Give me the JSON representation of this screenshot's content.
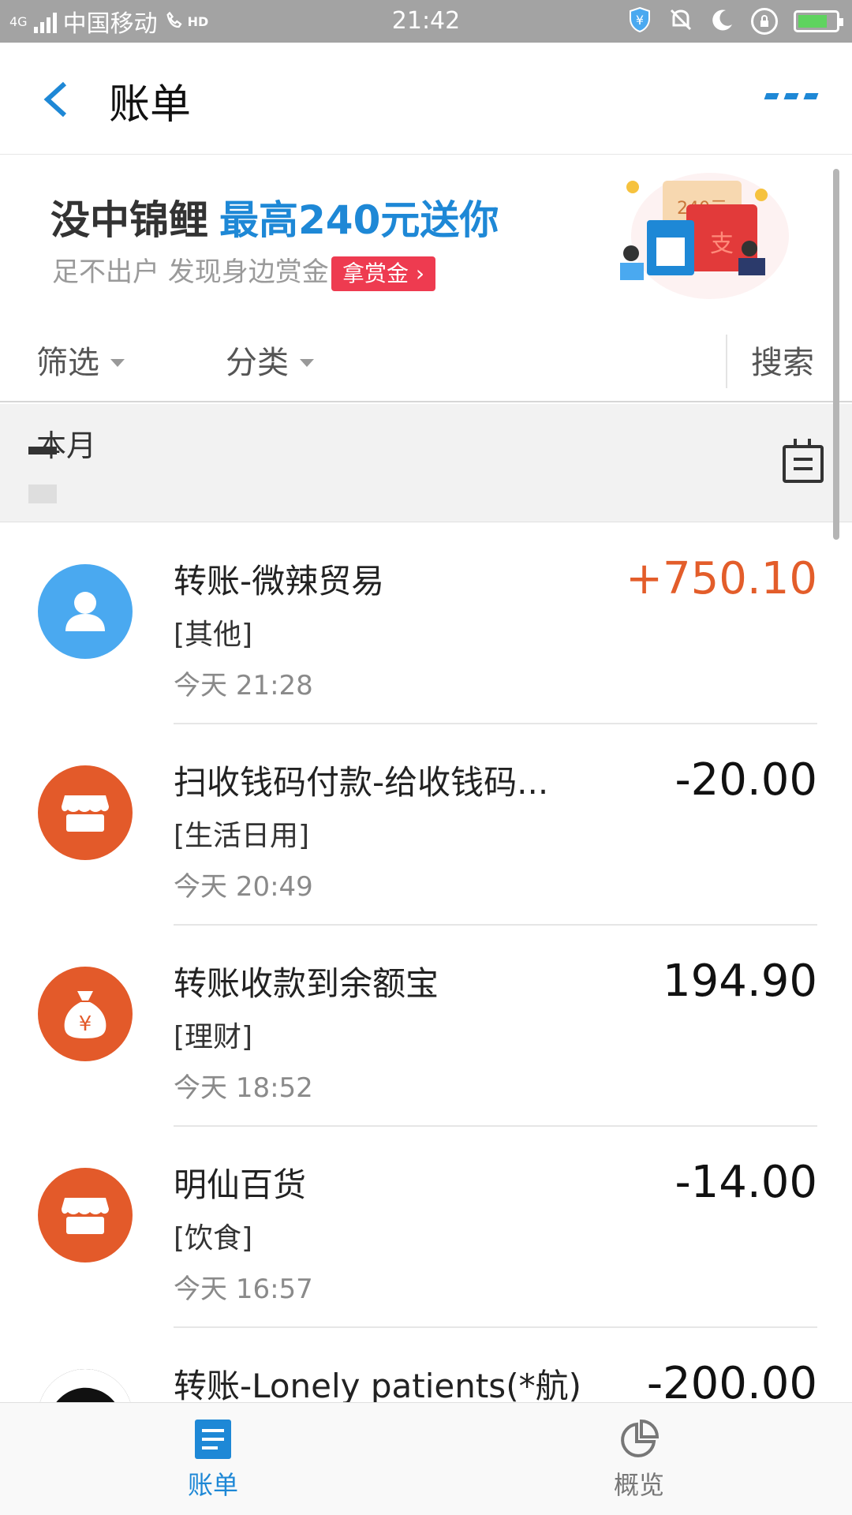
{
  "status_bar": {
    "network": "4G",
    "carrier": "中国移动",
    "hd": "HD",
    "time": "21:42"
  },
  "header": {
    "title": "账单"
  },
  "banner": {
    "title": "没中锦鲤",
    "title_highlight": "最高240元送你",
    "subtitle": "足不出户 发现身边赏金",
    "button_label": "拿赏金",
    "art_amount": "240元",
    "art_char": "支"
  },
  "filters": {
    "filter_label": "筛选",
    "category_label": "分类",
    "search_label": "搜索"
  },
  "month": {
    "label": "本月"
  },
  "transactions": [
    {
      "name": "转账-微辣贸易",
      "category": "[其他]",
      "day": "今天",
      "time": "21:28",
      "amount": "+750.10",
      "icon": "person-icon",
      "type": "income"
    },
    {
      "name": "扫收钱码付款-给收钱码...",
      "category": "[生活日用]",
      "day": "今天",
      "time": "20:49",
      "amount": "-20.00",
      "icon": "store-icon",
      "type": "expense"
    },
    {
      "name": "转账收款到余额宝",
      "category": "[理财]",
      "day": "今天",
      "time": "18:52",
      "amount": "194.90",
      "icon": "money-bag-icon",
      "type": "neutral"
    },
    {
      "name": "明仙百货",
      "category": "[饮食]",
      "day": "今天",
      "time": "16:57",
      "amount": "-14.00",
      "icon": "store-icon",
      "type": "expense"
    },
    {
      "name": "转账-Lonely patients(*航)",
      "category": "",
      "day": "",
      "time": "",
      "amount": "-200.00",
      "icon": "user-photo-avatar",
      "type": "expense"
    }
  ],
  "tabbar": {
    "bills_label": "账单",
    "overview_label": "概览"
  },
  "colors": {
    "accent": "#1e88d6",
    "income": "#e35d2a",
    "icon_orange": "#e35a2a",
    "icon_blue": "#4aa9f0",
    "banner_button": "#ee3b50"
  }
}
